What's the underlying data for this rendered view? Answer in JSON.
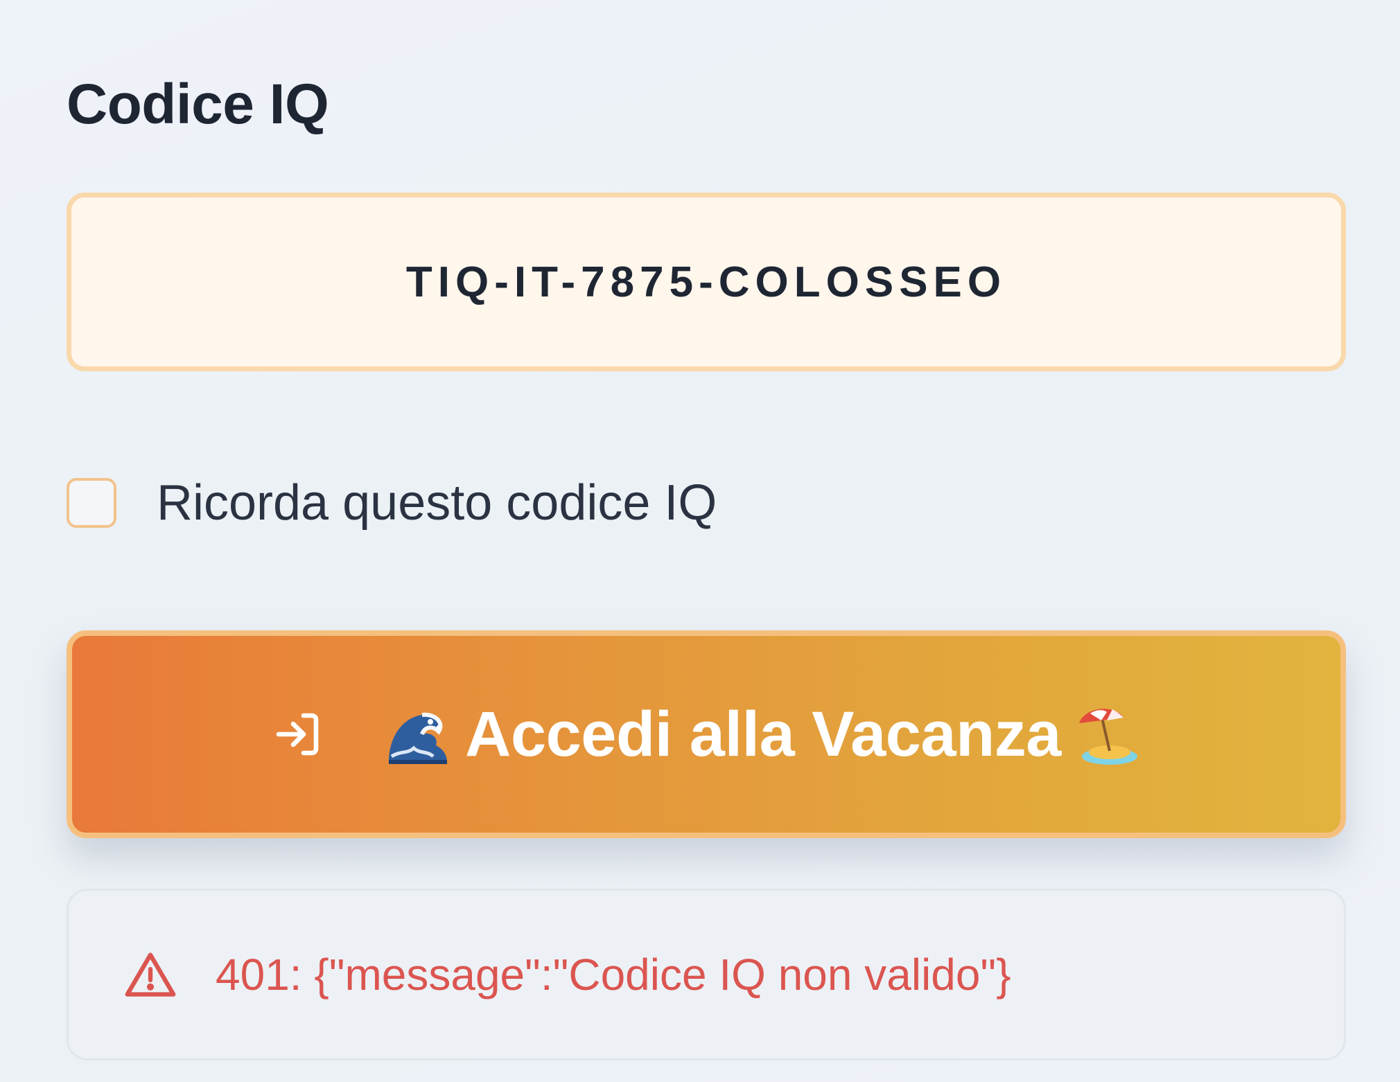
{
  "form": {
    "code_label": "Codice IQ",
    "code_value": "TIQ-IT-7875-COLOSSEO",
    "remember_label": "Ricorda questo codice IQ",
    "remember_checked": false
  },
  "submit": {
    "label": "Accedi alla Vacanza",
    "icon": "login-icon",
    "leading_emoji": "wave-emoji",
    "trailing_emoji": "beach-umbrella-emoji",
    "gradient_start": "#e8793a",
    "gradient_end": "#e2b43e"
  },
  "error": {
    "icon": "warning-icon",
    "message": "401: {\"message\":\"Codice IQ non valido\"}",
    "color": "#db5550"
  }
}
